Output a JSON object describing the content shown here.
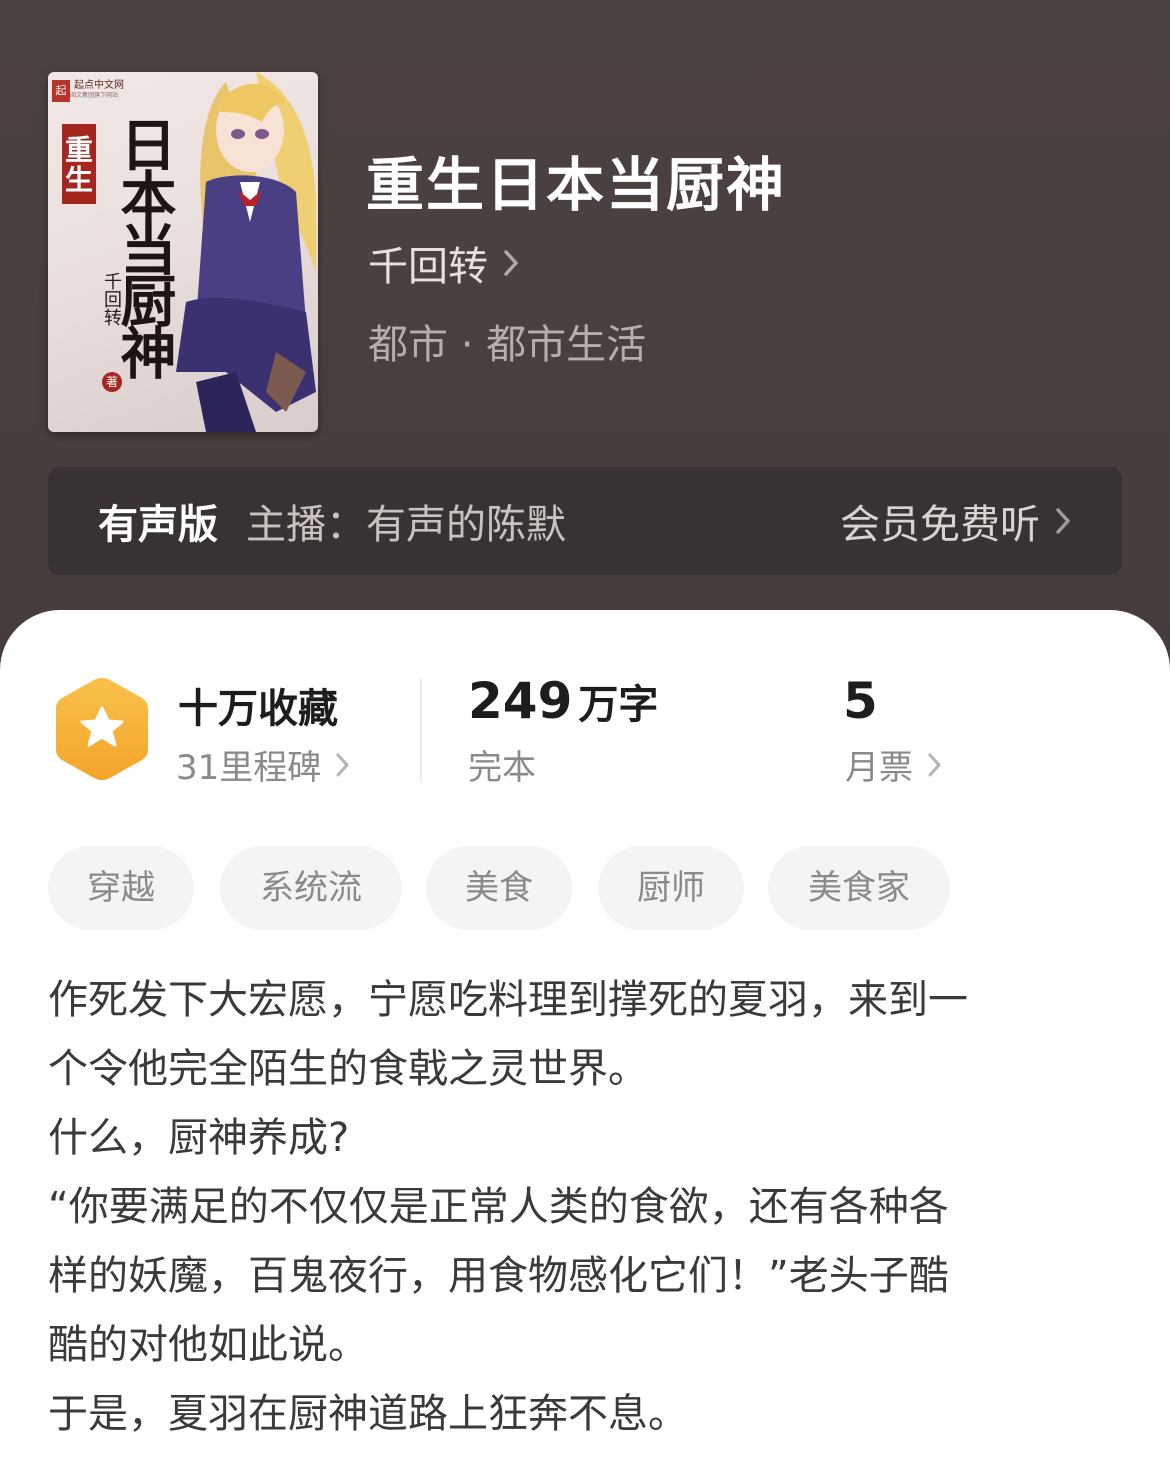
{
  "book": {
    "title": "重生日本当厨神",
    "author": "千回转",
    "category": "都市 · 都市生活"
  },
  "cover": {
    "publisher_mark": "起",
    "publisher_name": "起点中文网",
    "publisher_tagline": "阅文集团旗下网站",
    "title_prefix": "重生",
    "title_main": "日本当厨神",
    "author": "千回转",
    "author_suffix": "著"
  },
  "audio": {
    "label": "有声版",
    "host": "主播：有声的陈默",
    "cta": "会员免费听"
  },
  "stats": {
    "collect_main": "十万收藏",
    "collect_sub": "31里程碑",
    "words_num": "249",
    "words_unit": "万字",
    "status": "完本",
    "tickets_num": "5",
    "tickets_label": "月票"
  },
  "tags": [
    "穿越",
    "系统流",
    "美食",
    "厨师",
    "美食家"
  ],
  "description": [
    "作死发下大宏愿，宁愿吃料理到撑死的夏羽，来到一",
    "个令他完全陌生的食戟之灵世界。",
    "什么，厨神养成?",
    "“你要满足的不仅仅是正常人类的食欲，还有各种各",
    "样的妖魔，百鬼夜行，用食物感化它们！”老头子酷",
    "酷的对他如此说。",
    "于是，夏羽在厨神道路上狂奔不息。"
  ],
  "colors": {
    "header_bg": "#4a3f3f",
    "audio_bar_bg": "#383232",
    "badge_orange": "#f6b13a",
    "tag_bg": "#f4f4f4"
  },
  "icons": {
    "collect_badge": "star-hexagon-icon",
    "chevron": "chevron-right-icon"
  }
}
